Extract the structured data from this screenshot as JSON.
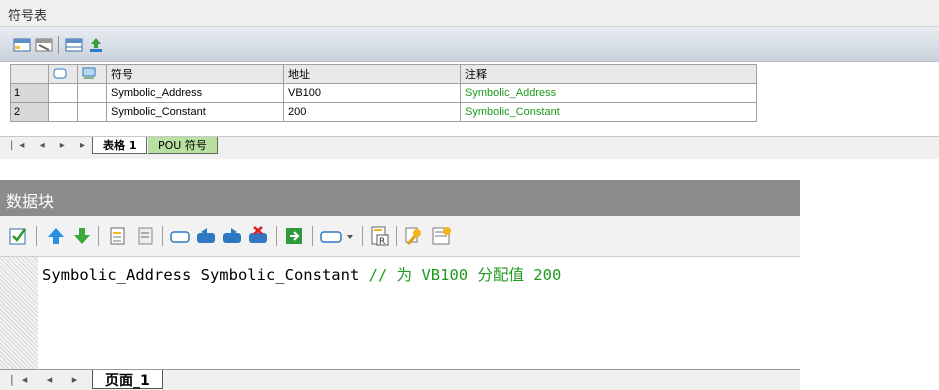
{
  "symbol_table": {
    "title": "符号表",
    "toolbar_icons": [
      "insert-row-icon",
      "delete-row-icon",
      "table-icon",
      "sort-icon"
    ],
    "columns": [
      "符号",
      "地址",
      "注释"
    ],
    "rows": [
      {
        "num": "1",
        "symbol": "Symbolic_Address",
        "address": "VB100",
        "comment": "Symbolic_Address"
      },
      {
        "num": "2",
        "symbol": "Symbolic_Constant",
        "address": "200",
        "comment": "Symbolic_Constant"
      }
    ],
    "nav": "|◂ ◂ ▸ ▸|",
    "tabs": [
      "表格 1",
      "POU 符号"
    ]
  },
  "data_block": {
    "title": "数据块",
    "code_main": "Symbolic_Address Symbolic_Constant ",
    "code_comment": "// 为 VB100 分配值 200",
    "nav": "|◂ ◂ ▸ ▸|",
    "tab": "页面_1"
  },
  "colors": {
    "comment_green": "#1e9a1e",
    "title_gray": "#8c8c8c"
  }
}
